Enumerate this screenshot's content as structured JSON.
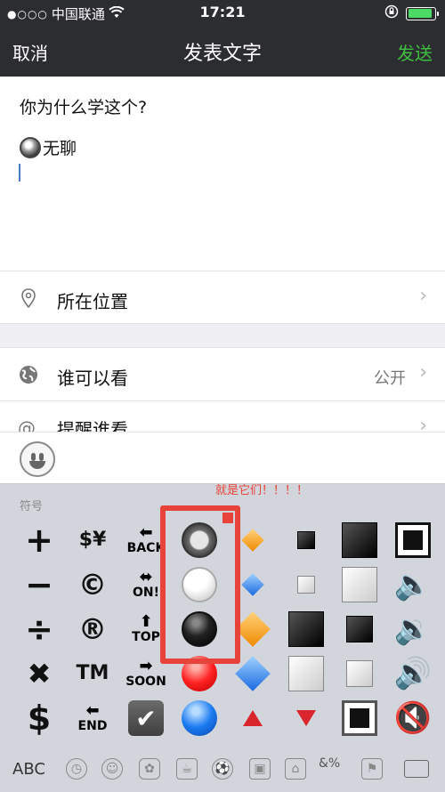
{
  "status_bar": {
    "carrier": "中国联通",
    "signal_dots": "●○○○",
    "time": "17:21"
  },
  "nav": {
    "cancel": "取消",
    "title": "发表文字",
    "send": "发送"
  },
  "compose": {
    "question": "你为什么学这个?",
    "answer": "无聊"
  },
  "rows": [
    {
      "label": "所在位置",
      "value": "",
      "icon": "location-pin-icon"
    },
    {
      "label": "谁可以看",
      "value": "公开",
      "icon": "globe-icon"
    },
    {
      "label": "提醒谁看",
      "value": "",
      "icon": "at-icon"
    }
  ],
  "emoji_panel": {
    "category_label": "符号",
    "annotation": "就是它们！！！！",
    "annotation_color": "#e8423a",
    "bottom_bar": {
      "abc": "ABC",
      "symbols_tab": "&%"
    }
  },
  "symbols": [
    [
      "+",
      "$¥",
      "BACK",
      "radio-button",
      "small-orange-diamond",
      "small-black-square",
      "large-black-square",
      "black-square-button"
    ],
    [
      "−",
      "©",
      "ON!",
      "white-circle",
      "small-blue-diamond",
      "small-white-square",
      "large-white-square",
      "speaker"
    ],
    [
      "÷",
      "®",
      "TOP",
      "black-circle",
      "large-orange-diamond",
      "large-black-square",
      "medium-black-square",
      "speaker-low"
    ],
    [
      "✖",
      "TM",
      "SOON",
      "red-circle",
      "large-blue-diamond",
      "large-white-square",
      "medium-white-square",
      "speaker-medium"
    ],
    [
      "$",
      "END",
      "check-box",
      "blue-circle",
      "red-triangle-up",
      "red-triangle-down",
      "white-square-button",
      "speaker-muted"
    ]
  ],
  "colors": {
    "nav_bg": "#2c2d31",
    "send_green": "#3fbf3f",
    "highlight": "#e8433a"
  }
}
